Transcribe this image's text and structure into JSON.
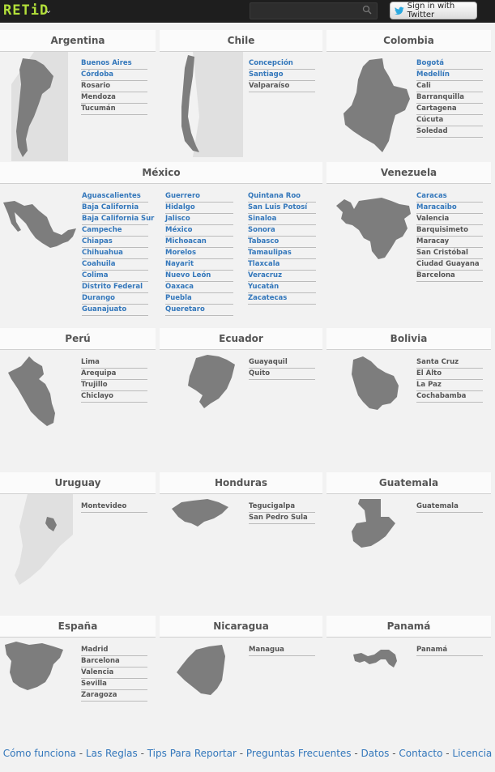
{
  "header": {
    "logo": "RETiD",
    "twitter_label": "Sign in with Twitter",
    "search_placeholder": ""
  },
  "countries": [
    {
      "name": "Argentina",
      "cities": [
        {
          "label": "Buenos Aires",
          "link": true
        },
        {
          "label": "Córdoba",
          "link": true
        },
        {
          "label": "Rosario",
          "link": false
        },
        {
          "label": "Mendoza",
          "link": false
        },
        {
          "label": "Tucumán",
          "link": false
        }
      ]
    },
    {
      "name": "Chile",
      "cities": [
        {
          "label": "Concepción",
          "link": true
        },
        {
          "label": "Santiago",
          "link": true
        },
        {
          "label": "Valparaíso",
          "link": false
        }
      ]
    },
    {
      "name": "Colombia",
      "cities": [
        {
          "label": "Bogotá",
          "link": true
        },
        {
          "label": "Medellín",
          "link": true
        },
        {
          "label": "Cali",
          "link": false
        },
        {
          "label": "Barranquilla",
          "link": false
        },
        {
          "label": "Cartagena",
          "link": false
        },
        {
          "label": "Cúcuta",
          "link": false
        },
        {
          "label": "Soledad",
          "link": false
        }
      ]
    },
    {
      "name": "México",
      "columns": [
        [
          {
            "label": "Aguascalientes",
            "link": true
          },
          {
            "label": "Baja California",
            "link": true
          },
          {
            "label": "Baja California Sur",
            "link": true
          },
          {
            "label": "Campeche",
            "link": true
          },
          {
            "label": "Chiapas",
            "link": true
          },
          {
            "label": "Chihuahua",
            "link": true
          },
          {
            "label": "Coahuila",
            "link": true
          },
          {
            "label": "Colima",
            "link": true
          },
          {
            "label": "Distrito Federal",
            "link": true
          },
          {
            "label": "Durango",
            "link": true
          },
          {
            "label": "Guanajuato",
            "link": true
          }
        ],
        [
          {
            "label": "Guerrero",
            "link": true
          },
          {
            "label": "Hidalgo",
            "link": true
          },
          {
            "label": "Jalisco",
            "link": true
          },
          {
            "label": "México",
            "link": true
          },
          {
            "label": "Michoacan",
            "link": true
          },
          {
            "label": "Morelos",
            "link": true
          },
          {
            "label": "Nayarit",
            "link": true
          },
          {
            "label": "Nuevo León",
            "link": true
          },
          {
            "label": "Oaxaca",
            "link": true
          },
          {
            "label": "Puebla",
            "link": true
          },
          {
            "label": "Queretaro",
            "link": true
          }
        ],
        [
          {
            "label": "Quintana Roo",
            "link": true
          },
          {
            "label": "San Luis Potosí",
            "link": true
          },
          {
            "label": "Sinaloa",
            "link": true
          },
          {
            "label": "Sonora",
            "link": true
          },
          {
            "label": "Tabasco",
            "link": true
          },
          {
            "label": "Tamaulipas",
            "link": true
          },
          {
            "label": "Tlaxcala",
            "link": true
          },
          {
            "label": "Veracruz",
            "link": true
          },
          {
            "label": "Yucatán",
            "link": true
          },
          {
            "label": "Zacatecas",
            "link": true
          }
        ]
      ]
    },
    {
      "name": "Venezuela",
      "cities": [
        {
          "label": "Caracas",
          "link": true
        },
        {
          "label": "Maracaibo",
          "link": true
        },
        {
          "label": "Valencia",
          "link": false
        },
        {
          "label": "Barquisimeto",
          "link": false
        },
        {
          "label": "Maracay",
          "link": false
        },
        {
          "label": "San Cristóbal",
          "link": false
        },
        {
          "label": "Ciudad Guayana",
          "link": false
        },
        {
          "label": "Barcelona",
          "link": false
        }
      ]
    },
    {
      "name": "Perú",
      "cities": [
        {
          "label": "Lima",
          "link": false
        },
        {
          "label": "Arequipa",
          "link": false
        },
        {
          "label": "Trujillo",
          "link": false
        },
        {
          "label": "Chiclayo",
          "link": false
        }
      ]
    },
    {
      "name": "Ecuador",
      "cities": [
        {
          "label": "Guayaquil",
          "link": false
        },
        {
          "label": "Quito",
          "link": false
        }
      ]
    },
    {
      "name": "Bolivia",
      "cities": [
        {
          "label": "Santa Cruz",
          "link": false
        },
        {
          "label": "El Alto",
          "link": false
        },
        {
          "label": "La Paz",
          "link": false
        },
        {
          "label": "Cochabamba",
          "link": false
        }
      ]
    },
    {
      "name": "Uruguay",
      "cities": [
        {
          "label": "Montevideo",
          "link": false
        }
      ]
    },
    {
      "name": "Honduras",
      "cities": [
        {
          "label": "Tegucigalpa",
          "link": false
        },
        {
          "label": "San Pedro Sula",
          "link": false
        }
      ]
    },
    {
      "name": "Guatemala",
      "cities": [
        {
          "label": "Guatemala",
          "link": false
        }
      ]
    },
    {
      "name": "España",
      "cities": [
        {
          "label": "Madrid",
          "link": false
        },
        {
          "label": "Barcelona",
          "link": false
        },
        {
          "label": "Valencia",
          "link": false
        },
        {
          "label": "Sevilla",
          "link": false
        },
        {
          "label": "Zaragoza",
          "link": false
        }
      ]
    },
    {
      "name": "Nicaragua",
      "cities": [
        {
          "label": "Managua",
          "link": false
        }
      ]
    },
    {
      "name": "Panamá",
      "cities": [
        {
          "label": "Panamá",
          "link": false
        }
      ]
    }
  ],
  "footer": {
    "links": [
      "Cómo funciona",
      "Las Reglas",
      "Tips Para Reportar",
      "Preguntas Frecuentes",
      "Datos",
      "Contacto",
      "Licencia"
    ],
    "separator": " - "
  },
  "colors": {
    "link": "#3377bb",
    "map": "#7d7d7d",
    "map_light": "#d6d6d6",
    "logo": "#b3e03a"
  }
}
